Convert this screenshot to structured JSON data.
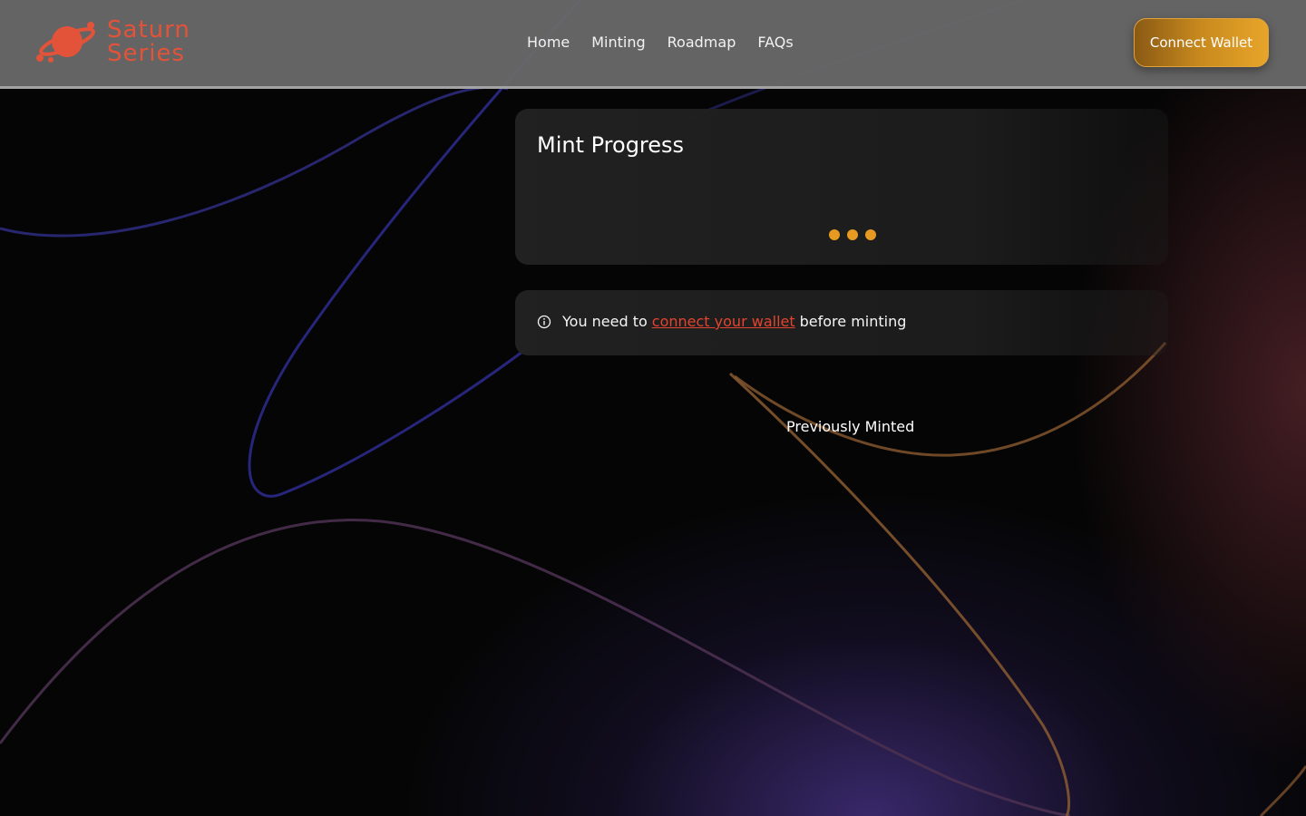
{
  "brand": {
    "line1": "Saturn",
    "line2": "Series",
    "logo_icon": "saturn-planet-icon",
    "color": "#e2533a"
  },
  "nav": {
    "items": [
      {
        "label": "Home"
      },
      {
        "label": "Minting"
      },
      {
        "label": "Roadmap"
      },
      {
        "label": "FAQs"
      }
    ]
  },
  "header": {
    "connect_label": "Connect Wallet"
  },
  "mint_progress": {
    "title": "Mint Progress",
    "loader_icon": "loading-dots-icon",
    "loader_color": "#e69a22"
  },
  "notice": {
    "icon": "info-circle-icon",
    "text_before": "You need to",
    "link_text": "connect your wallet",
    "text_after": "before minting",
    "link_color": "#e2452f"
  },
  "previously_minted": {
    "label": "Previously Minted"
  },
  "colors": {
    "accent": "#e69a22",
    "header_bg": "#696969",
    "background": "#050505"
  }
}
